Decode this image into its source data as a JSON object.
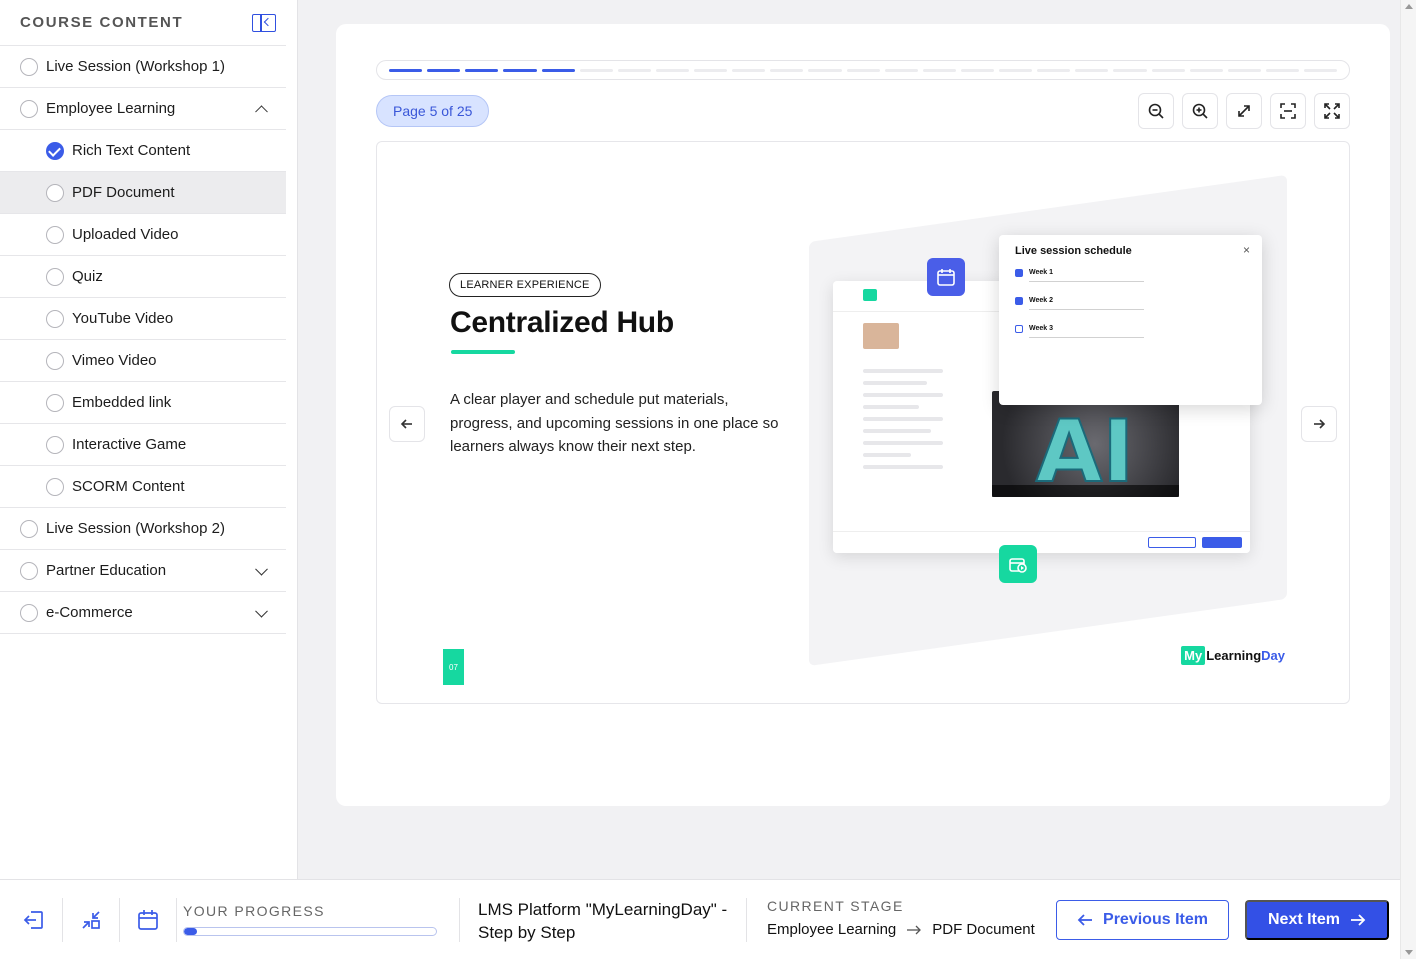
{
  "sidebar": {
    "title": "COURSE CONTENT",
    "items": [
      {
        "label": "Live Session (Workshop 1)",
        "level": 0,
        "state": "empty"
      },
      {
        "label": "Employee Learning",
        "level": 0,
        "state": "empty",
        "expanded": true
      },
      {
        "label": "Rich Text Content",
        "level": 1,
        "state": "checked"
      },
      {
        "label": "PDF Document",
        "level": 1,
        "state": "empty",
        "active": true
      },
      {
        "label": "Uploaded Video",
        "level": 1,
        "state": "empty"
      },
      {
        "label": "Quiz",
        "level": 1,
        "state": "empty"
      },
      {
        "label": "YouTube Video",
        "level": 1,
        "state": "empty"
      },
      {
        "label": "Vimeo Video",
        "level": 1,
        "state": "empty"
      },
      {
        "label": "Embedded link",
        "level": 1,
        "state": "empty"
      },
      {
        "label": "Interactive Game",
        "level": 1,
        "state": "empty"
      },
      {
        "label": "SCORM Content",
        "level": 1,
        "state": "empty"
      },
      {
        "label": "Live Session (Workshop 2)",
        "level": 0,
        "state": "empty"
      },
      {
        "label": "Partner Education",
        "level": 0,
        "state": "empty",
        "expanded": false
      },
      {
        "label": "e-Commerce",
        "level": 0,
        "state": "empty",
        "expanded": false
      }
    ]
  },
  "viewer": {
    "page_label": "Page 5 of 25",
    "current_page": 5,
    "total_pages": 25,
    "tools": [
      "zoom-out-icon",
      "zoom-in-icon",
      "expand-icon",
      "fit-screen-icon",
      "fullscreen-icon"
    ]
  },
  "slide": {
    "tag": "LEARNER EXPERIENCE",
    "title": "Centralized Hub",
    "description": "A clear player and schedule put materials, progress, and upcoming sessions in one place so learners always know their next step.",
    "page_number": "07",
    "schedule": {
      "title": "Live session schedule",
      "weeks": [
        "Week 1",
        "Week 2",
        "Week 3"
      ]
    },
    "brand": {
      "my": "My",
      "learning": "Learning",
      "day": "Day"
    }
  },
  "bottom": {
    "progress_label": "YOUR PROGRESS",
    "progress_fraction": 0.05,
    "course_title": "LMS Platform \"MyLearningDay\" - Step by Step",
    "stage_label": "CURRENT STAGE",
    "stage_from": "Employee Learning",
    "stage_to": "PDF Document",
    "prev_label": "Previous Item",
    "next_label": "Next Item"
  },
  "colors": {
    "accent": "#3b5ce8",
    "brand_green": "#16d8a0"
  }
}
